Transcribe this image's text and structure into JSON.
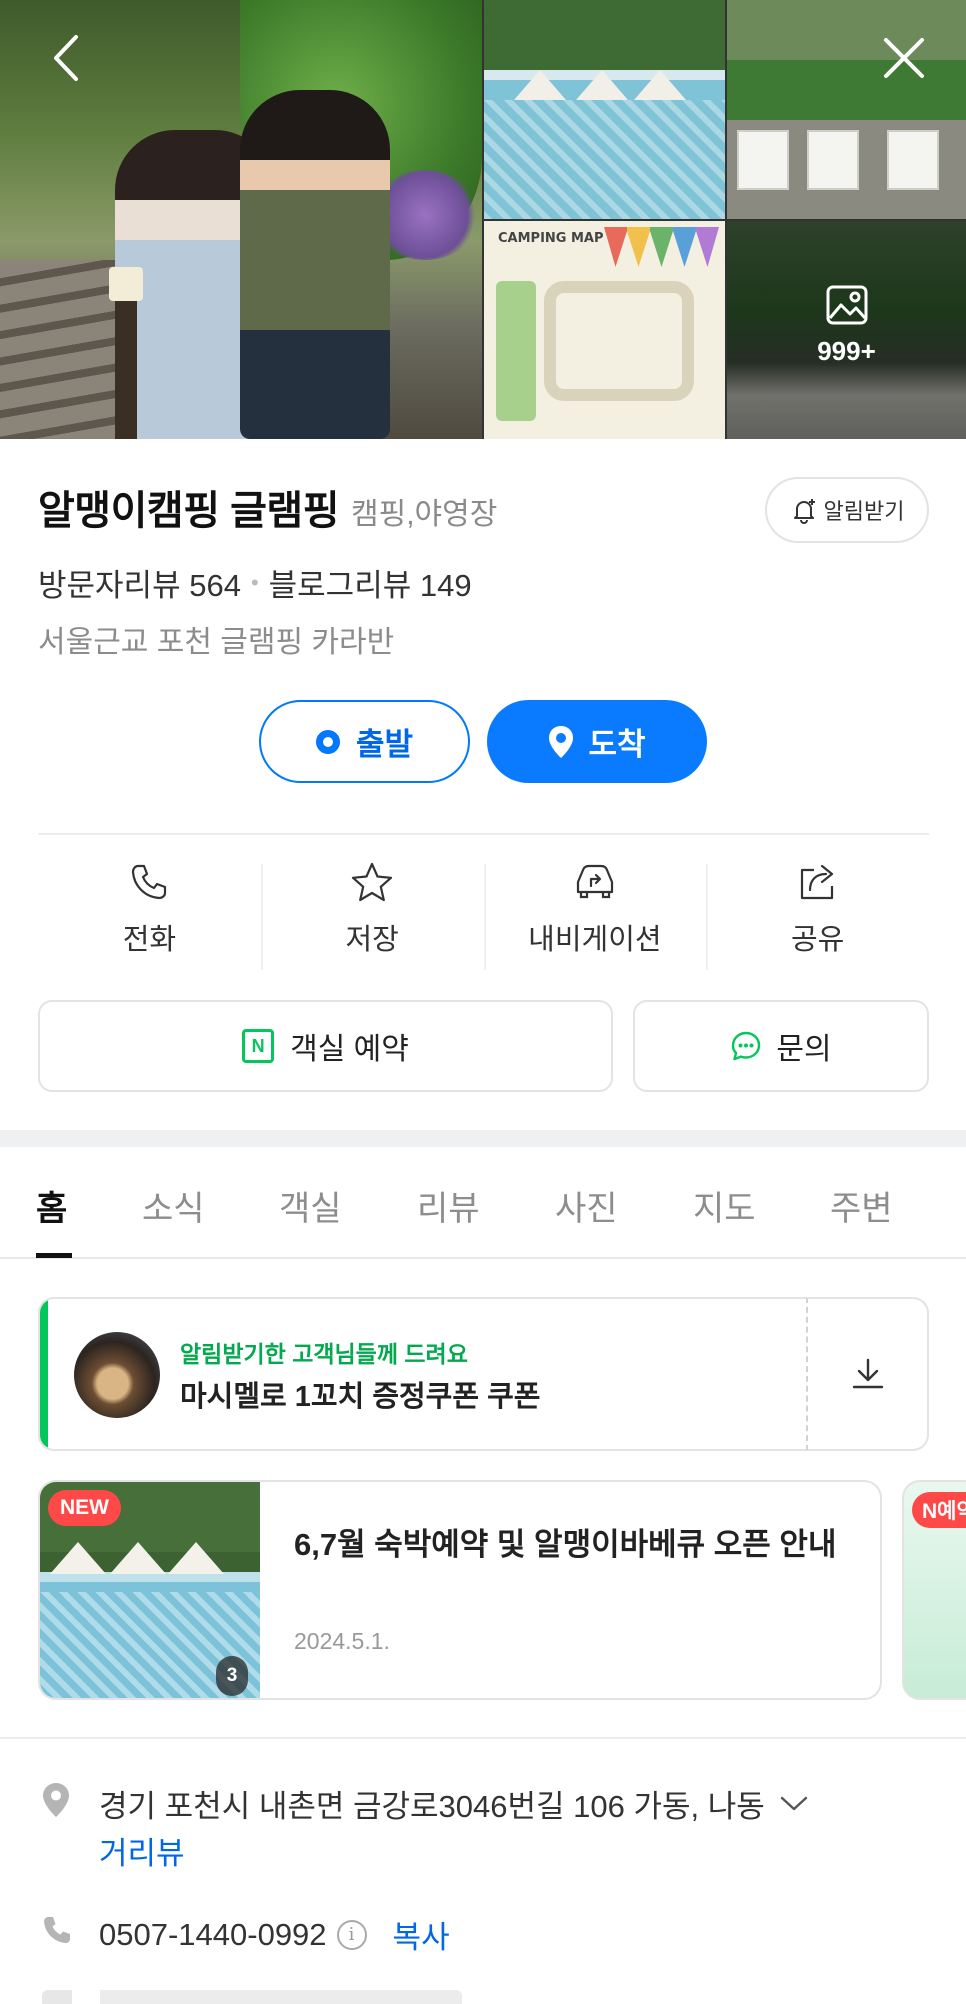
{
  "gallery": {
    "map_label": "CAMPING MAP",
    "more_photos": "999+"
  },
  "place": {
    "name": "알맹이캠핑 글램핑",
    "category": "캠핑,야영장",
    "notify_label": "알림받기",
    "visitor_reviews": "방문자리뷰 564",
    "blog_reviews": "블로그리뷰 149",
    "description": "서울근교 포천 글램핑 카라반"
  },
  "route": {
    "start_label": "출발",
    "destination_label": "도착"
  },
  "actions": [
    {
      "label": "전화",
      "icon": "phone-icon"
    },
    {
      "label": "저장",
      "icon": "star-icon"
    },
    {
      "label": "내비게이션",
      "icon": "car-icon"
    },
    {
      "label": "공유",
      "icon": "share-icon"
    }
  ],
  "booking": {
    "reserve_label": "객실 예약",
    "reserve_badge": "N",
    "inquiry_label": "문의"
  },
  "tabs": [
    "홈",
    "소식",
    "객실",
    "리뷰",
    "사진",
    "지도",
    "주변"
  ],
  "coupon": {
    "hint": "알림받기한 고객님들께 드려요",
    "title": "마시멜로 1꼬치 증정쿠폰 쿠폰"
  },
  "news": {
    "badge": "NEW",
    "photo_count": "3",
    "title": "6,7월 숙박예약 및 알맹이바베큐 오픈 안내",
    "date": "2024.5.1.",
    "next_badge": "N예약"
  },
  "info": {
    "address": "경기 포천시 내촌면 금강로3046번길 106 가동, 나동",
    "street_view": "거리뷰",
    "phone": "0507-1440-0992",
    "info_symbol": "i",
    "copy_label": "복사"
  },
  "colors": {
    "primary_blue": "#0a7bff",
    "naver_green": "#03c75a",
    "badge_red": "#ff4848"
  }
}
